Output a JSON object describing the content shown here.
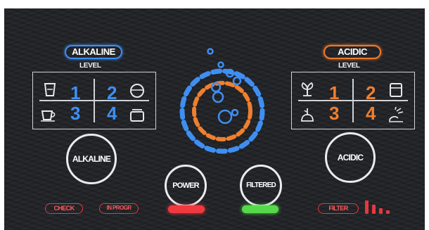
{
  "alkaline_section": {
    "badge_label": "ALKALINE",
    "level_label": "LEVEL",
    "levels": [
      "1",
      "2",
      "3",
      "4"
    ],
    "icons": [
      "cup-icon",
      "egg-icon",
      "tea-cup-icon",
      "pot-icon"
    ],
    "button_label": "ALKALINE"
  },
  "acidic_section": {
    "badge_label": "ACIDIC",
    "level_label": "LEVEL",
    "levels": [
      "1",
      "2",
      "3",
      "4"
    ],
    "icons": [
      "plant-icon",
      "laundry-icon",
      "flower-icon",
      "watering-icon"
    ],
    "button_label": "ACIDIC"
  },
  "center": {
    "power_label": "POWER",
    "filtered_label": "FILTERED",
    "power_led_color": "#f0393f",
    "filtered_led_color": "#55d94a"
  },
  "status": {
    "check_label": "CHECK",
    "in_progress_label": "IN PROGR",
    "filter_label": "FILTER",
    "filter_level_bars": 4
  },
  "colors": {
    "alkaline_blue": "#3f8ff2",
    "acidic_orange": "#f07f2e",
    "warning_red": "#e8383c",
    "panel_bg": "#232529"
  }
}
